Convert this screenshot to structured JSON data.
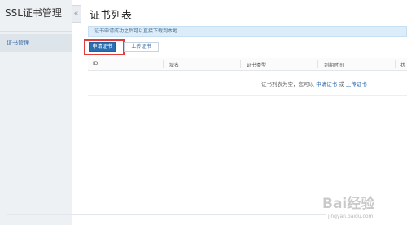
{
  "sidebar": {
    "title": "SSL证书管理",
    "items": [
      {
        "label": "证书管理"
      }
    ],
    "collapse_glyph": "«"
  },
  "main": {
    "title": "证书列表",
    "notice": "证书申请成功之后可以直接下载到本地",
    "buttons": {
      "apply": "申请证书",
      "upload": "上传证书"
    },
    "table": {
      "columns": [
        "ID",
        "域名",
        "证书类型",
        "到期时间",
        "状"
      ],
      "empty_message": {
        "prefix": "证书列表为空，您可以",
        "apply_link": "申请证书",
        "or": "或",
        "upload_link": "上传证书"
      }
    }
  },
  "watermark": {
    "logo": "Bai经验",
    "url": "jingyan.baidu.com"
  },
  "colors": {
    "primary": "#2b6fb2",
    "highlight": "#e23b3b",
    "notice_bg": "#dcecf9"
  }
}
